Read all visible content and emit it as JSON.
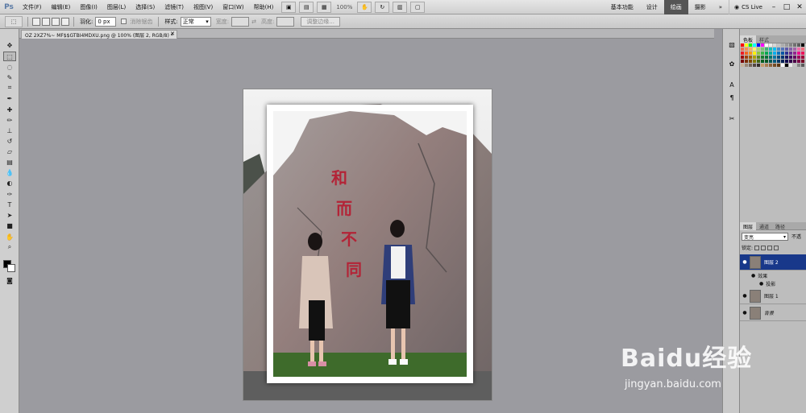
{
  "app": {
    "logo": "Ps"
  },
  "menu": [
    "文件(F)",
    "编辑(E)",
    "图像(I)",
    "图层(L)",
    "选择(S)",
    "滤镜(T)",
    "视图(V)",
    "窗口(W)",
    "帮助(H)"
  ],
  "menubar": {
    "zoom": "100%"
  },
  "workspaces": [
    "基本功能",
    "设计",
    "绘画",
    "摄影"
  ],
  "workspace_more": "»",
  "cs_live": "CS Live",
  "window_controls": [
    "–",
    "□",
    "✕"
  ],
  "options": {
    "feather_label": "羽化:",
    "feather_value": "0 px",
    "antialias_label": "消除锯齿",
    "style_label": "样式:",
    "style_value": "正常",
    "width_label": "宽度:",
    "height_label": "高度:",
    "refine_edge": "调整边缘..."
  },
  "document": {
    "tab_title": "OZ 2XZ7%~ MF$$GTBI4MDXU.png @ 100% (图层 2, RGB/8) *",
    "close": "✕"
  },
  "panels": {
    "swatch_tabs": [
      "色板",
      "样式"
    ],
    "swatches": [
      "#ff0000",
      "#ffff00",
      "#00ff00",
      "#00ffff",
      "#0000ff",
      "#ff00ff",
      "#ffffff",
      "#ebebeb",
      "#d6d6d6",
      "#c2c2c2",
      "#adadad",
      "#999999",
      "#858585",
      "#707070",
      "#5c5c5c",
      "#000000",
      "#f26c4f",
      "#f68e55",
      "#fbaf5c",
      "#fff467",
      "#acd372",
      "#7cc576",
      "#3bb878",
      "#1abbb4",
      "#00bff3",
      "#438ccb",
      "#5574b9",
      "#605ca8",
      "#855fa8",
      "#a763a8",
      "#f06ea9",
      "#f26d7d",
      "#ed1c24",
      "#f26522",
      "#f7941d",
      "#fff200",
      "#8dc63f",
      "#39b54a",
      "#00a651",
      "#00a99d",
      "#00aeef",
      "#0072bc",
      "#0054a6",
      "#2e3192",
      "#662d91",
      "#92278f",
      "#ec008c",
      "#ed145b",
      "#9e0b0f",
      "#a0410d",
      "#a36209",
      "#aba000",
      "#598527",
      "#1a7b30",
      "#007236",
      "#00746b",
      "#0076a3",
      "#004b80",
      "#003471",
      "#1b1464",
      "#440e62",
      "#630460",
      "#9e005d",
      "#9e0039",
      "#790000",
      "#7b2e00",
      "#7d4900",
      "#827b00",
      "#406618",
      "#005e20",
      "#005826",
      "#005952",
      "#005b7f",
      "#003663",
      "#002157",
      "#0d004c",
      "#32004b",
      "#4b0049",
      "#7b0046",
      "#7a0026",
      "#c7b299",
      "#998675",
      "#736357",
      "#534741",
      "#37302d",
      "#c69c6d",
      "#a67c52",
      "#8c6239",
      "#754c24",
      "#603913",
      "#ffffff",
      "#000000",
      "#ebebeb",
      "#c2c2c2",
      "#858585",
      "#5c5c5c"
    ],
    "layer_tabs": [
      "图层",
      "通道",
      "路径"
    ],
    "blend_mode": "变亮",
    "opacity_label": "不透",
    "lock_label": "锁定:",
    "layers": [
      {
        "name": "图层 2",
        "selected": true
      },
      {
        "name": "效果",
        "sub": true
      },
      {
        "name": "投影",
        "sub": true
      },
      {
        "name": "图层 1",
        "selected": false
      },
      {
        "name": "背景",
        "selected": false
      }
    ]
  },
  "photo": {
    "calligraphy": "和而不同"
  },
  "watermark": {
    "brand": "Baidu经验",
    "url": "jingyan.baidu.com"
  }
}
